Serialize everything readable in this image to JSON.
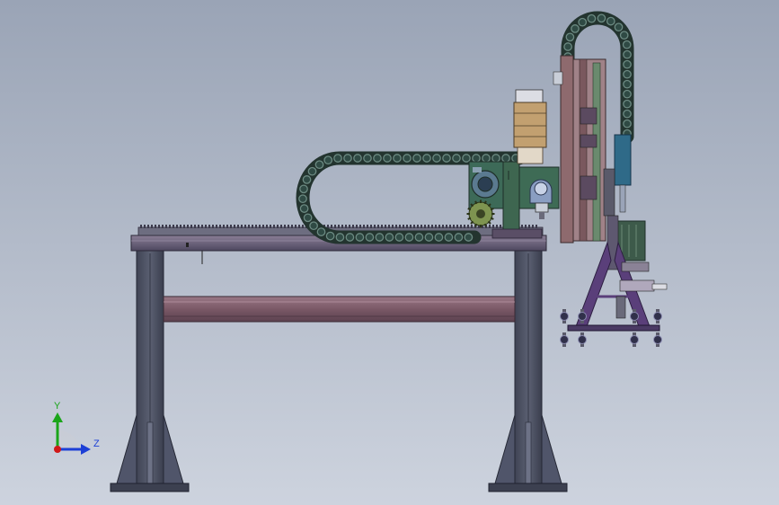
{
  "view": {
    "background_top": "#9aa4b6",
    "background_bottom": "#cdd3de"
  },
  "model": {
    "frame_color": "#4b4f60",
    "beam_color": "#7a5866",
    "rail_color": "#5e5a72",
    "chain_color": "#2f4a44",
    "chain_link_highlight": "#6c8a82",
    "motor_color": "#3e6b55",
    "carriage_plate_color": "#8a6e72",
    "blue_part_color": "#2f5f7a",
    "gripper_color": "#5a3f7a"
  },
  "triad": {
    "y_label": "Y",
    "z_label": "Z",
    "y_color": "#1aa51a",
    "z_color": "#1c3fd6",
    "origin_color": "#d01818"
  }
}
